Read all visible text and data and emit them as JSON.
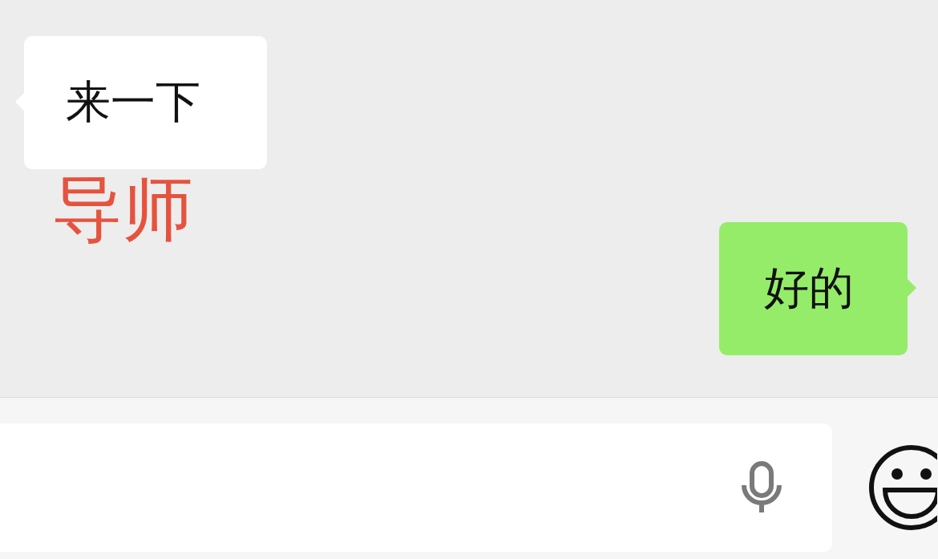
{
  "messages": [
    {
      "kind": "incoming",
      "text": "来一下",
      "caption": "导师"
    },
    {
      "kind": "outgoing",
      "text": "好的"
    }
  ]
}
